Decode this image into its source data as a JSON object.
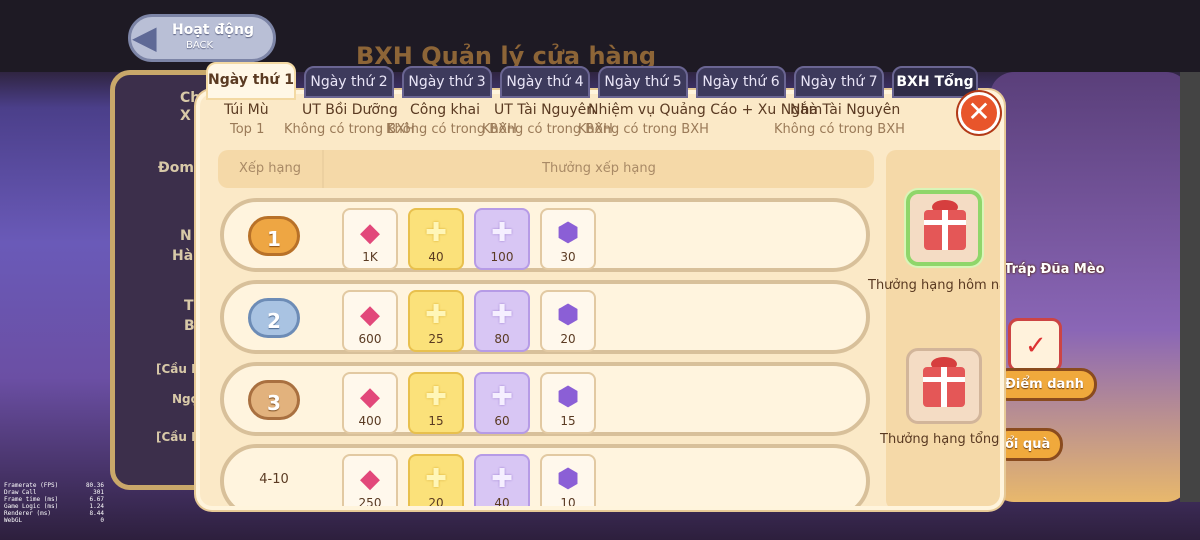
{
  "back_button": {
    "title": "Hoạt động",
    "subtitle": "BACK"
  },
  "background": {
    "title": "BXH Quản lý cửa hàng",
    "left_texts": [
      "Ch",
      "X",
      "Đom",
      "N",
      "Hà",
      "T",
      "B",
      "[Cầu N",
      "Ngọ",
      "[Cầu N"
    ],
    "right_labels": [
      "Tráp Đũa Mèo",
      "Điểm danh",
      "ổi quà"
    ]
  },
  "tabs": [
    {
      "label": "Ngày thứ 1",
      "active": true
    },
    {
      "label": "Ngày thứ 2"
    },
    {
      "label": "Ngày thứ 3"
    },
    {
      "label": "Ngày thứ 4"
    },
    {
      "label": "Ngày thứ 5"
    },
    {
      "label": "Ngày thứ 6"
    },
    {
      "label": "Ngày thứ 7"
    },
    {
      "label": "BXH Tổng"
    }
  ],
  "categories": [
    {
      "name": "Túi Mù",
      "status": "Top 1"
    },
    {
      "name": "UT Bồi Dưỡng",
      "status": "Không có trong BXH"
    },
    {
      "name": "Công khai",
      "status": "Không có trong BXH"
    },
    {
      "name": "UT Tài Nguyên",
      "status": "Không có trong BXH"
    },
    {
      "name": "Nhiệm vụ Quảng Cáo + Xu Ngắm",
      "status": "Không có trong BXH"
    },
    {
      "name": "Nhà Tài Nguyên",
      "status": "Không có trong BXH"
    }
  ],
  "close_icon": "✕",
  "table_header": {
    "rank": "Xếp hạng",
    "reward": "Thưởng xếp hạng"
  },
  "ranks": [
    {
      "rank": "1",
      "badge": "gold",
      "rewards": [
        {
          "type": "gem",
          "qty": "1K"
        },
        {
          "type": "gold",
          "qty": "40"
        },
        {
          "type": "purple",
          "qty": "100"
        },
        {
          "type": "badge",
          "qty": "30"
        }
      ]
    },
    {
      "rank": "2",
      "badge": "silver",
      "rewards": [
        {
          "type": "gem",
          "qty": "600"
        },
        {
          "type": "gold",
          "qty": "25"
        },
        {
          "type": "purple",
          "qty": "80"
        },
        {
          "type": "badge",
          "qty": "20"
        }
      ]
    },
    {
      "rank": "3",
      "badge": "bronze",
      "rewards": [
        {
          "type": "gem",
          "qty": "400"
        },
        {
          "type": "gold",
          "qty": "15"
        },
        {
          "type": "purple",
          "qty": "60"
        },
        {
          "type": "badge",
          "qty": "15"
        }
      ]
    },
    {
      "rank": "4-10",
      "badge": "text",
      "rewards": [
        {
          "type": "gem",
          "qty": "250"
        },
        {
          "type": "gold",
          "qty": "20"
        },
        {
          "type": "purple",
          "qty": "40"
        },
        {
          "type": "badge",
          "qty": "10"
        }
      ]
    }
  ],
  "icons": {
    "gem": "◆",
    "gold": "✚",
    "purple": "✚",
    "badge": "⬢"
  },
  "gifts": [
    {
      "label": "Thưởng hạng hôm nay",
      "selected": true
    },
    {
      "label": "Thưởng hạng tổng",
      "selected": false
    }
  ],
  "perf_stats": [
    {
      "label": "Framerate (FPS)",
      "value": "80.36"
    },
    {
      "label": "Draw Call",
      "value": "301"
    },
    {
      "label": "Frame time (ms)",
      "value": "6.67"
    },
    {
      "label": "Game Logic (ms)",
      "value": "1.24"
    },
    {
      "label": "Renderer (ms)",
      "value": "8.44"
    },
    {
      "label": "WebGL",
      "value": "0"
    }
  ],
  "colors": {
    "panel": "#fbe9c7",
    "tab_active": "#fff7e6",
    "tab_inactive": "#3d3a5c",
    "close": "#e8552b",
    "gift_selected_border": "#8fd66a"
  }
}
